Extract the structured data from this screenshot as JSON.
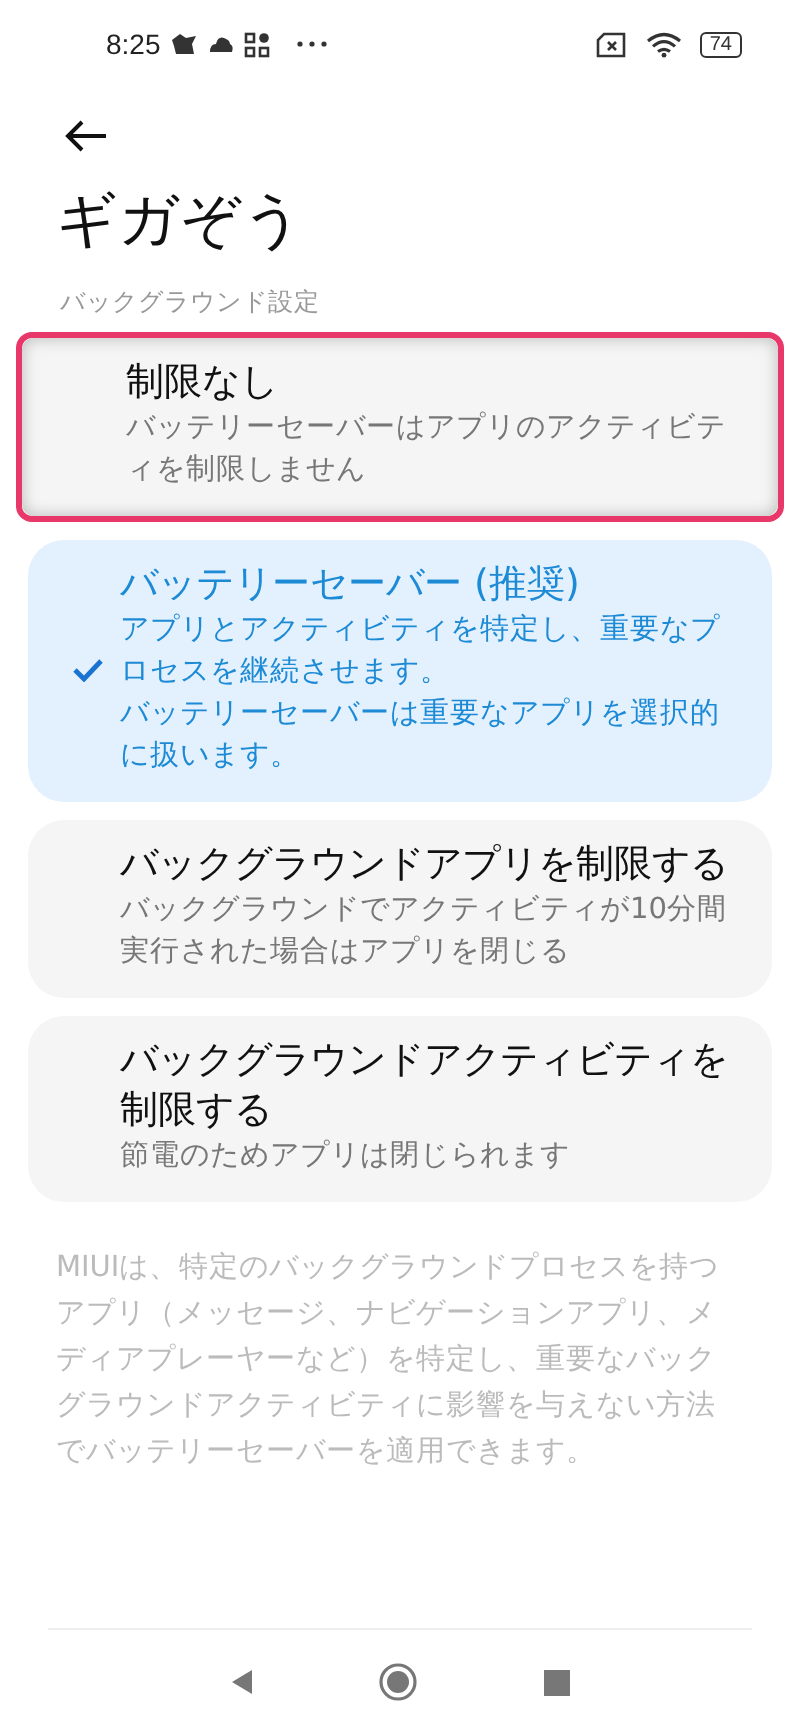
{
  "status_bar": {
    "time": "8:25",
    "battery": "74"
  },
  "header": {
    "title": "ギガぞう"
  },
  "section_label": "バックグラウンド設定",
  "options": [
    {
      "title": "制限なし",
      "description": [
        "バッテリーセーバーはアプリのアクティビティを制限しません"
      ],
      "selected": false,
      "highlighted": true
    },
    {
      "title": "バッテリーセーバー (推奨)",
      "description": [
        "アプリとアクティビティを特定し、重要なプロセスを継続させます。",
        "バッテリーセーバーは重要なアプリを選択的に扱います。"
      ],
      "selected": true,
      "highlighted": false
    },
    {
      "title": "バックグラウンドアプリを制限する",
      "description": [
        "バックグラウンドでアクティビティが10分間実行された場合はアプリを閉じる"
      ],
      "selected": false,
      "highlighted": false
    },
    {
      "title": "バックグラウンドアクティビティを制限する",
      "description": [
        "節電のためアプリは閉じられます"
      ],
      "selected": false,
      "highlighted": false
    }
  ],
  "footer_note": "MIUIは、特定のバックグラウンドプロセスを持つアプリ（メッセージ、ナビゲーションアプリ、メディアプレーヤーなど）を特定し、重要なバックグラウンドアクティビティに影響を与えない方法でバッテリーセーバーを適用できます。"
}
